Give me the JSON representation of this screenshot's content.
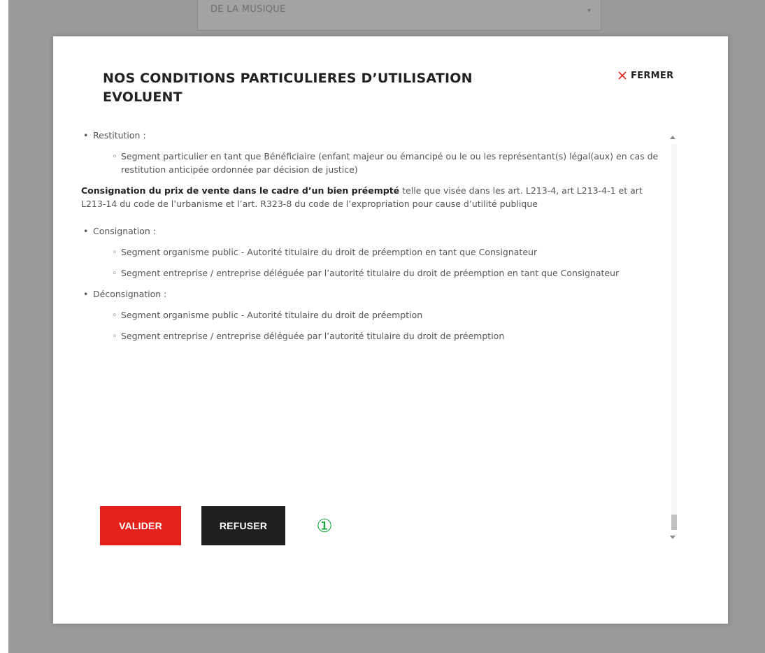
{
  "background": {
    "select_value": "DE LA MUSIQUE"
  },
  "modal": {
    "title": "NOS CONDITIONS PARTICULIERES D’UTILISATION EVOLUENT",
    "close_label": "FERMER",
    "content": {
      "restitution_label": "Restitution :",
      "restitution_items": [
        "Segment particulier en tant que Bénéficiaire (enfant majeur ou émancipé ou le ou les représentant(s) légal(aux) en cas de restitution anticipée ordonnée par décision de justice)"
      ],
      "para_bold": "Consignation du prix de vente dans le cadre d’un bien préempté",
      "para_rest": " telle que visée dans les art. L213-4, art L213-4-1 et art L213-14 du code de l’urbanisme et l’art. R323-8 du code de l’expropriation pour cause d’utilité publique",
      "consignation_label": "Consignation :",
      "consignation_items": [
        "Segment organisme public - Autorité titulaire du droit de préemption en tant que Consignateur",
        "Segment entreprise / entreprise déléguée par l’autorité titulaire du droit de préemption en tant que Consignateur"
      ],
      "deconsignation_label": "Déconsignation :",
      "deconsignation_items": [
        "Segment organisme public - Autorité titulaire du droit de préemption",
        "Segment entreprise / entreprise déléguée par l’autorité titulaire du droit de préemption"
      ]
    },
    "buttons": {
      "validate": "VALIDER",
      "refuse": "REFUSER"
    },
    "annotation_marker": "①"
  },
  "colors": {
    "validate_bg": "#e2221b",
    "refuse_bg": "#1f1f1f",
    "close_icon": "#e2221b",
    "marker": "#1aa33b"
  },
  "icons": {
    "close": "close-icon",
    "scroll_up": "chevron-up-icon",
    "scroll_down": "chevron-down-icon"
  }
}
